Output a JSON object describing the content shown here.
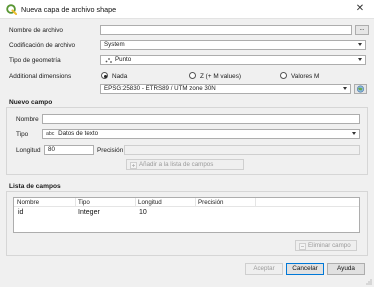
{
  "window": {
    "title": "Nueva capa de archivo shape",
    "close_glyph": "✕"
  },
  "form": {
    "file_name_label": "Nombre de archivo",
    "file_name_value": "",
    "browse_label": "...",
    "encoding_label": "Codificación de archivo",
    "encoding_value": "System",
    "geometry_label": "Tipo de geometría",
    "geometry_value": "Punto",
    "dimensions_label": "Additional dimensions",
    "dimensions_options": [
      "Nada",
      "Z (+ M values)",
      "Valores M"
    ],
    "dimensions_selected": "Nada",
    "crs_value": "EPSG:25830 - ETRS89 / UTM zone 30N"
  },
  "new_field": {
    "title": "Nuevo campo",
    "name_label": "Nombre",
    "name_value": "",
    "type_label": "Tipo",
    "type_icon_text": "abc",
    "type_value": "Datos de texto",
    "length_label": "Longitud",
    "length_value": "80",
    "precision_label": "Precisión",
    "precision_value": "",
    "add_button": "Añadir a la lista de campos"
  },
  "field_list": {
    "title": "Lista de campos",
    "columns": [
      "Nombre",
      "Tipo",
      "Longitud",
      "Precisión"
    ],
    "rows": [
      {
        "name": "id",
        "type": "Integer",
        "length": "10",
        "precision": ""
      }
    ],
    "remove_button": "Eliminar campo"
  },
  "buttons": {
    "accept": "Aceptar",
    "cancel": "Cancelar",
    "help": "Ayuda"
  },
  "colors": {
    "accent": "#0078d7",
    "qgis_green": "#589632",
    "qgis_yellow": "#eebc2f"
  }
}
